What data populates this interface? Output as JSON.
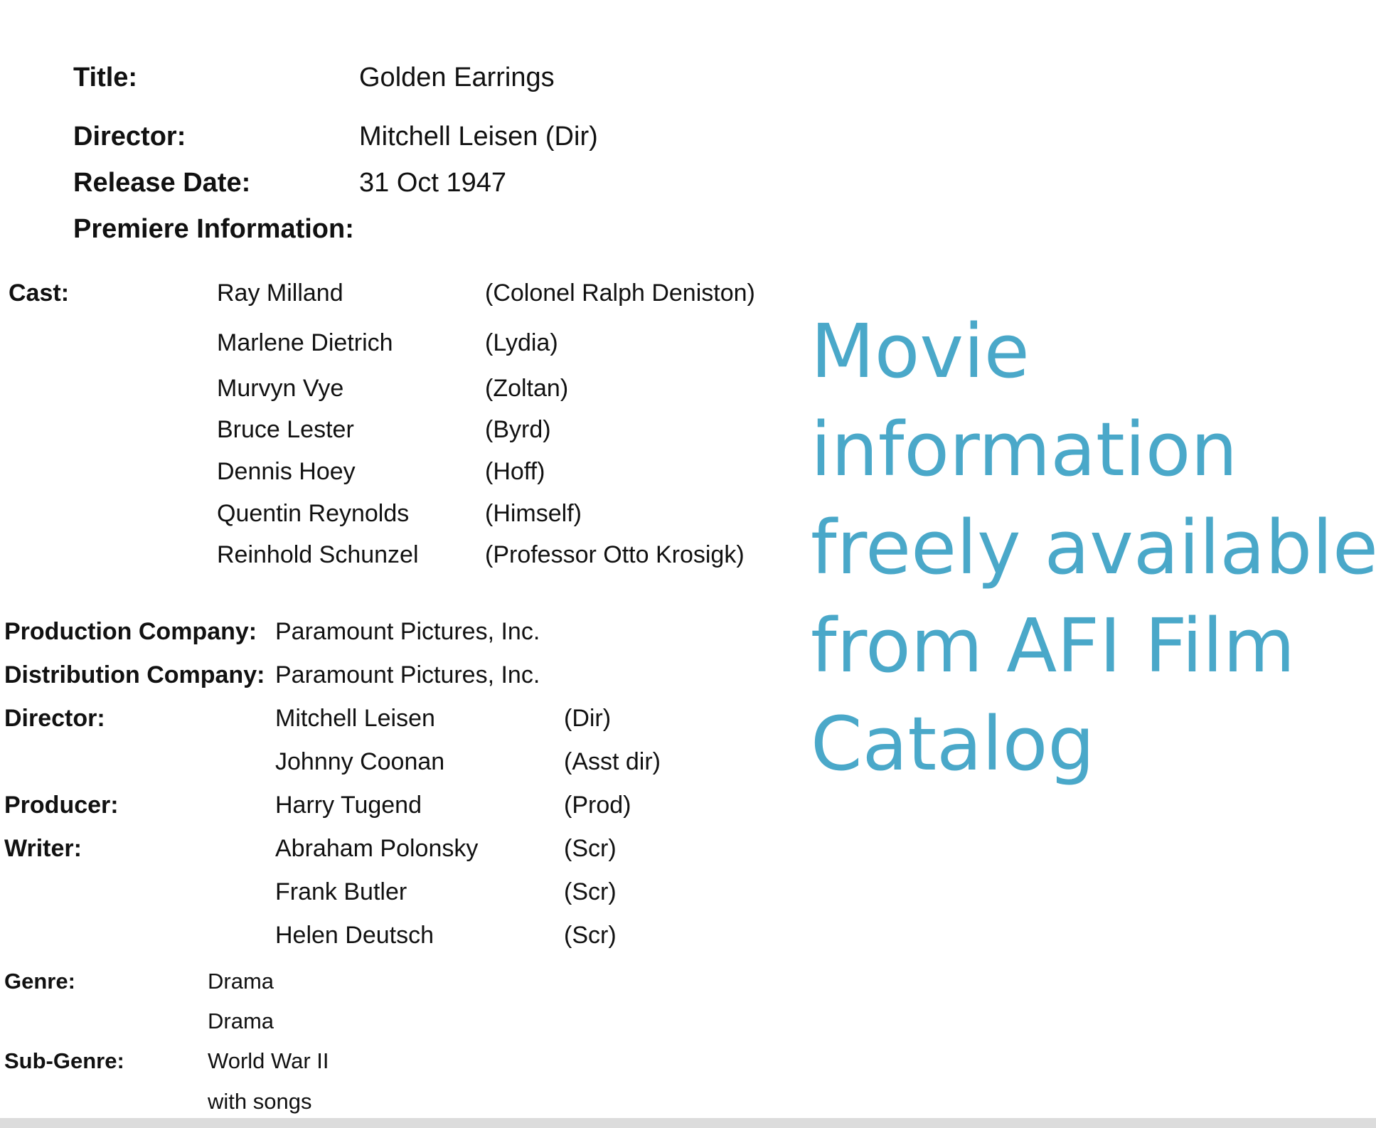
{
  "header_info": {
    "title_label": "Title:",
    "title_value": "Golden Earrings",
    "director_label": "Director:",
    "director_value": "Mitchell Leisen  (Dir)",
    "release_label": "Release Date:",
    "release_value": "31 Oct 1947",
    "premiere_label": "Premiere Information:"
  },
  "cast": {
    "label": "Cast:",
    "rows": [
      {
        "actor": "Ray Milland",
        "role": "(Colonel Ralph Deniston)"
      },
      {
        "actor": "Marlene Dietrich",
        "role": "(Lydia)"
      },
      {
        "actor": "Murvyn Vye",
        "role": "(Zoltan)"
      },
      {
        "actor": "Bruce Lester",
        "role": "(Byrd)"
      },
      {
        "actor": "Dennis Hoey",
        "role": "(Hoff)"
      },
      {
        "actor": "Quentin Reynolds",
        "role": "(Himself)"
      },
      {
        "actor": "Reinhold Schunzel",
        "role": "(Professor Otto Krosigk)"
      }
    ]
  },
  "companies": {
    "production_label": "Production Company:",
    "production_value": "Paramount Pictures, Inc.",
    "distribution_label": "Distribution Company:",
    "distribution_value": "Paramount Pictures, Inc."
  },
  "crew": {
    "director_label": "Director:",
    "producer_label": "Producer:",
    "writer_label": "Writer:",
    "rows": [
      {
        "name": "Mitchell Leisen",
        "role": "(Dir)"
      },
      {
        "name": "Johnny Coonan",
        "role": "(Asst dir)"
      },
      {
        "name": "Harry Tugend",
        "role": "(Prod)"
      },
      {
        "name": "Abraham Polonsky",
        "role": "(Scr)"
      },
      {
        "name": "Frank Butler",
        "role": "(Scr)"
      },
      {
        "name": "Helen Deutsch",
        "role": "(Scr)"
      }
    ]
  },
  "genres": {
    "genre_label": "Genre:",
    "genre_values": [
      "Drama",
      "Drama"
    ],
    "subgenre_label": "Sub-Genre:",
    "subgenre_values": [
      "World War II",
      "with songs"
    ]
  },
  "caption": {
    "lines": [
      "Movie",
      "information",
      "freely available",
      "from AFI Film",
      "Catalog"
    ]
  },
  "colors": {
    "caption": "#4aa8c9",
    "text": "#111111",
    "background": "#ffffff",
    "bottom_bar": "#dcdcdc"
  }
}
